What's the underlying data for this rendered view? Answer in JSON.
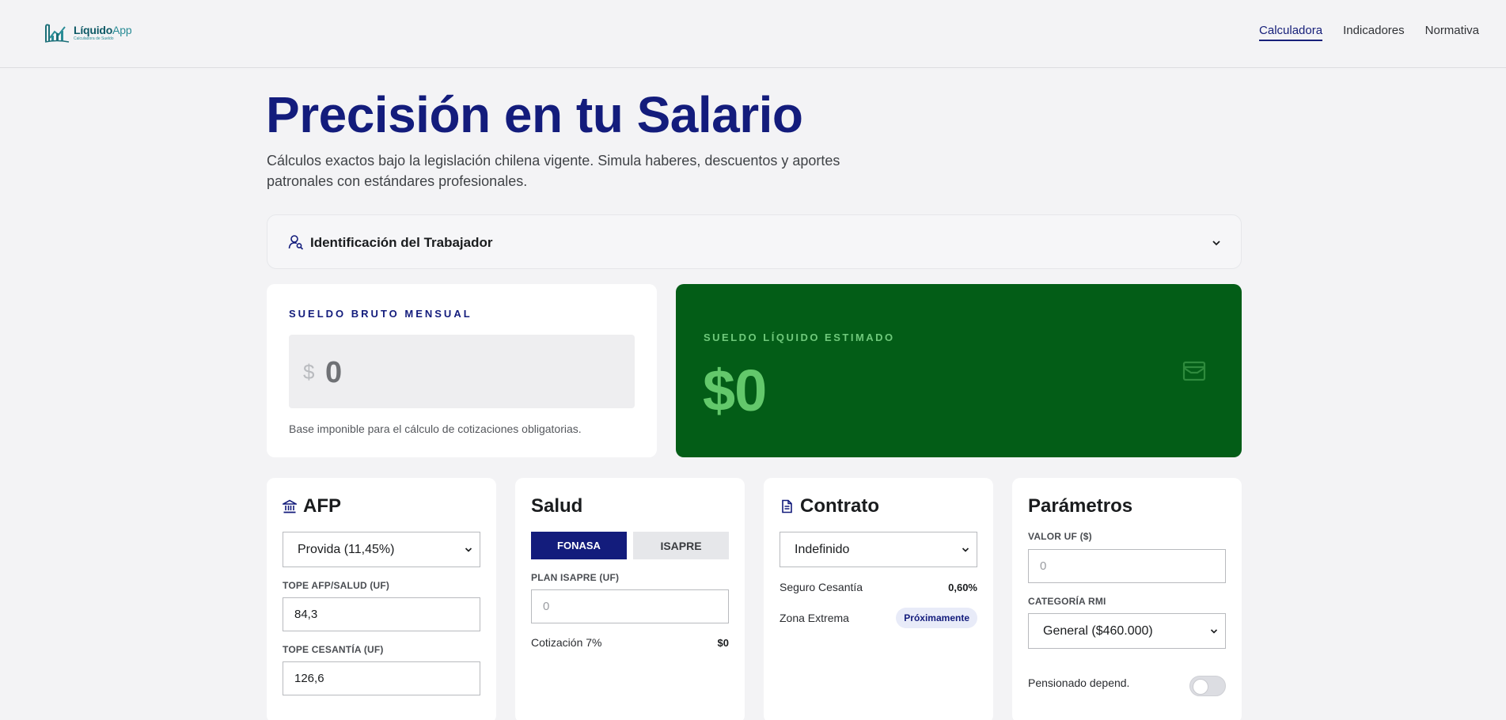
{
  "header": {
    "logo_name": "Líquido",
    "logo_name_suffix": "App",
    "logo_tagline": "Calculadora de Sueldo",
    "nav": [
      {
        "label": "Calculadora",
        "active": true
      },
      {
        "label": "Indicadores",
        "active": false
      },
      {
        "label": "Normativa",
        "active": false
      }
    ]
  },
  "hero": {
    "title": "Precisión en tu Salario",
    "subtitle": "Cálculos exactos bajo la legislación chilena vigente. Simula haberes, descuentos y aportes patronales con estándares profesionales."
  },
  "worker_section": {
    "label": "Identificación del Trabajador",
    "icon": "user-search-icon"
  },
  "gross": {
    "label": "SUELDO BRUTO MENSUAL",
    "currency": "$",
    "value": "0",
    "note": "Base imponible para el cálculo de cotizaciones obligatorias."
  },
  "net": {
    "label": "SUELDO LÍQUIDO ESTIMADO",
    "value": "$0",
    "icon": "wallet-icon"
  },
  "afp": {
    "title": "AFP",
    "icon": "bank-icon",
    "selected": "Provida (11,45%)",
    "tope_label": "TOPE AFP/SALUD (UF)",
    "tope_value": "84,3",
    "cesantia_label": "TOPE CESANTÍA (UF)",
    "cesantia_value": "126,6"
  },
  "salud": {
    "title": "Salud",
    "options": [
      "FONASA",
      "ISAPRE"
    ],
    "active": "FONASA",
    "plan_label": "PLAN ISAPRE (UF)",
    "plan_placeholder": "0",
    "cotizacion_label": "Cotización 7%",
    "cotizacion_value": "$0"
  },
  "contrato": {
    "title": "Contrato",
    "icon": "document-icon",
    "selected": "Indefinido",
    "seguro_label": "Seguro Cesantía",
    "seguro_value": "0,60%",
    "zona_label": "Zona Extrema",
    "zona_badge": "Próximamente"
  },
  "parametros": {
    "title": "Parámetros",
    "uf_label": "VALOR UF ($)",
    "uf_placeholder": "0",
    "rmi_label": "CATEGORÍA RMI",
    "rmi_selected": "General ($460.000)",
    "pensionado_label": "Pensionado depend.",
    "pensionado_on": false
  },
  "colors": {
    "primary": "#131c7c",
    "net_bg": "#035d17",
    "net_accent": "#63c86b"
  }
}
